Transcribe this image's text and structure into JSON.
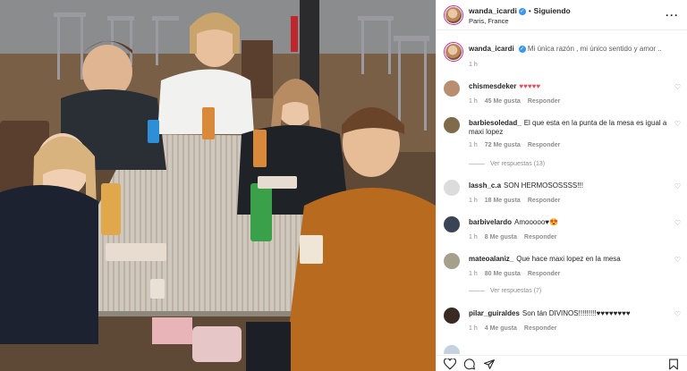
{
  "post": {
    "username": "wanda_icardi",
    "following_label": "Siguiendo",
    "location": "Paris, France",
    "caption": "Mi única razón , mi único sentido y amor ..",
    "caption_time": "1 h"
  },
  "comments": [
    {
      "user": "chismesdeker",
      "text": "♥♥♥♥♥",
      "time": "1 h",
      "likes": "45 Me gusta",
      "reply": "Responder"
    },
    {
      "user": "barbiesoledad_",
      "text": "El que esta en la punta de la mesa es igual a maxi lopez",
      "time": "1 h",
      "likes": "72 Me gusta",
      "reply": "Responder",
      "replies": "Ver respuestas (13)"
    },
    {
      "user": "lassh_c.a",
      "text": "SON HERMOSOSSSS!!!",
      "time": "1 h",
      "likes": "18 Me gusta",
      "reply": "Responder"
    },
    {
      "user": "barbivelardo",
      "text": "Amooooo♥😍",
      "time": "1 h",
      "likes": "8 Me gusta",
      "reply": "Responder"
    },
    {
      "user": "mateoalaniz_",
      "text": "Que hace maxi lopez en la mesa",
      "time": "1 h",
      "likes": "80 Me gusta",
      "reply": "Responder",
      "replies": "Ver respuestas (7)"
    },
    {
      "user": "pilar_guiraldes",
      "text": "Son tán DIVINOS!!!!!!!!!♥♥♥♥♥♥♥♥",
      "time": "1 h",
      "likes": "4 Me gusta",
      "reply": "Responder"
    }
  ],
  "colors": {
    "accent": "#3897f0",
    "heart": "#ed4956",
    "muted": "#8e8e8e"
  },
  "icons": [
    "more-icon",
    "heart-icon",
    "comment-icon",
    "share-icon",
    "bookmark-icon",
    "verified-icon"
  ]
}
